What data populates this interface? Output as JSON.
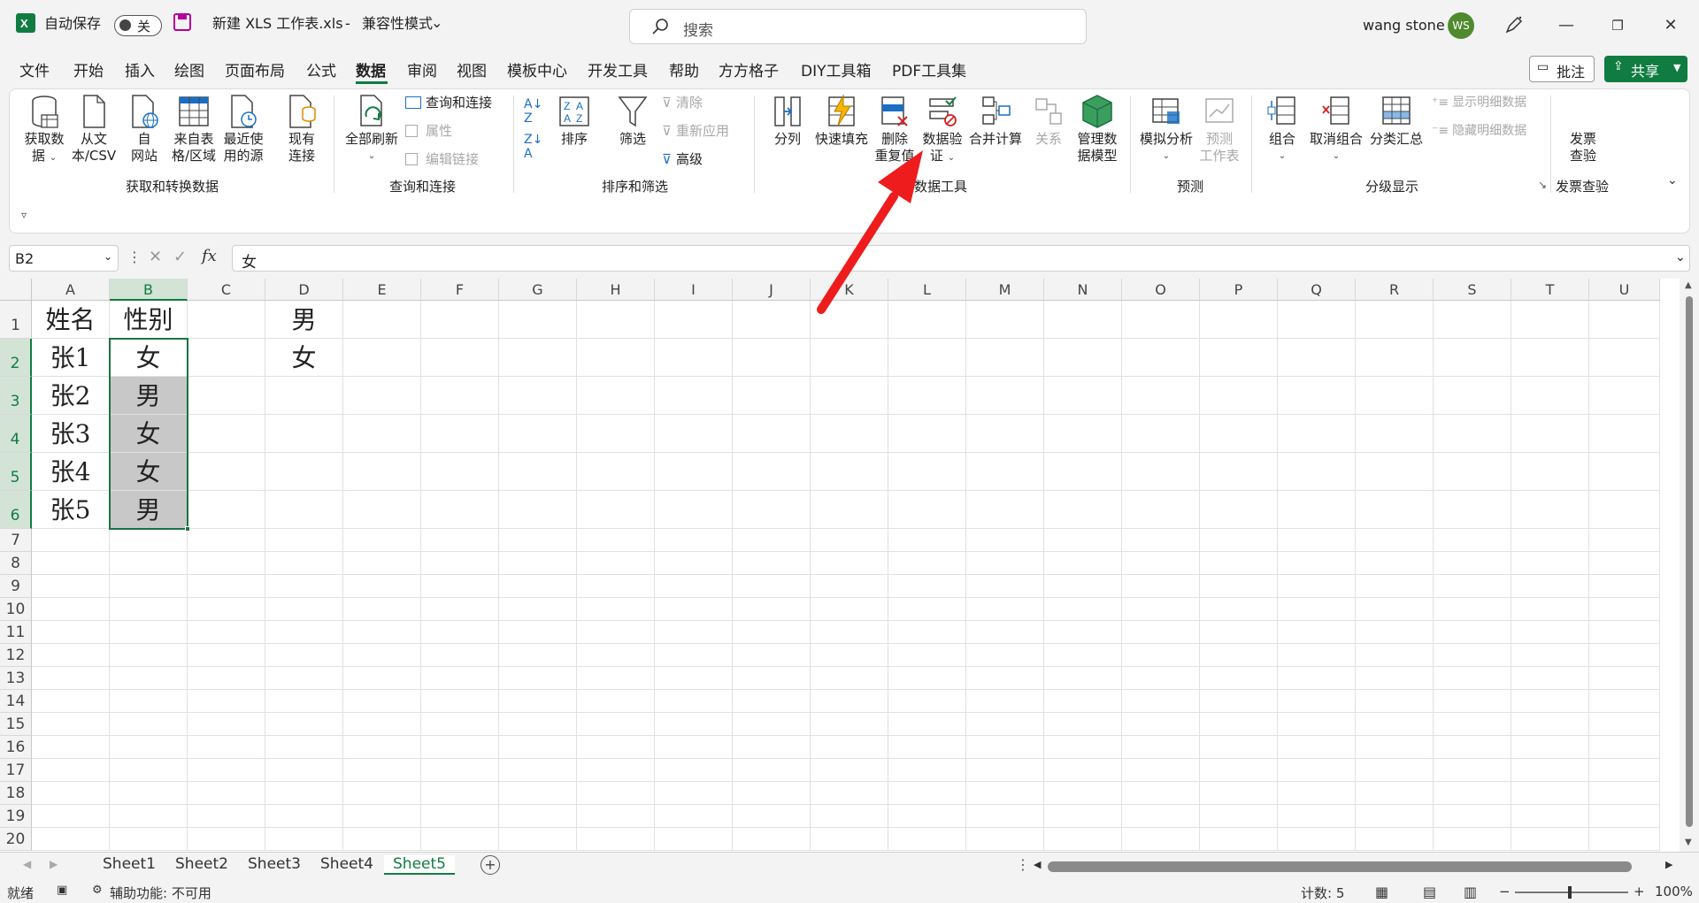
{
  "title": {
    "autosave_label": "自动保存",
    "autosave_state": "关",
    "filename": "新建 XLS 工作表.xls",
    "separator": "-",
    "mode": "兼容性模式",
    "search_placeholder": "搜索",
    "user_name": "wang stone",
    "avatar_initials": "WS"
  },
  "menu": {
    "items": [
      "文件",
      "开始",
      "插入",
      "绘图",
      "页面布局",
      "公式",
      "数据",
      "审阅",
      "视图",
      "模板中心",
      "开发工具",
      "帮助",
      "方方格子",
      "DIY工具箱",
      "PDF工具集"
    ],
    "active": "数据",
    "comment_label": "批注",
    "share_label": "共享"
  },
  "ribbon": {
    "groups": {
      "get_data": "获取和转换数据",
      "query": "查询和连接",
      "sort_filter": "排序和筛选",
      "data_tools": "数据工具",
      "forecast": "预测",
      "outline": "分级显示",
      "invoice": "发票查验"
    },
    "buttons": {
      "get_data_1": "获取数",
      "get_data_2": "据",
      "from_text_1": "从文",
      "from_text_2": "本/CSV",
      "from_web_1": "自",
      "from_web_2": "网站",
      "from_table_1": "来自表",
      "from_table_2": "格/区域",
      "recent_1": "最近使",
      "recent_2": "用的源",
      "existing_1": "现有",
      "existing_2": "连接",
      "refresh_all": "全部刷新",
      "queries": "查询和连接",
      "properties": "属性",
      "edit_links": "编辑链接",
      "sort": "排序",
      "filter": "筛选",
      "clear": "清除",
      "reapply": "重新应用",
      "advanced": "高级",
      "text_to_columns": "分列",
      "flash_fill": "快速填充",
      "remove_dup_1": "删除",
      "remove_dup_2": "重复值",
      "data_valid_1": "数据验",
      "data_valid_2": "证",
      "consolidate": "合并计算",
      "relationships": "关系",
      "manage_model_1": "管理数",
      "manage_model_2": "据模型",
      "whatif": "模拟分析",
      "forecast_1": "预测",
      "forecast_2": "工作表",
      "group": "组合",
      "ungroup": "取消组合",
      "subtotal": "分类汇总",
      "show_detail": "显示明细数据",
      "hide_detail": "隐藏明细数据",
      "invoice_1": "发票",
      "invoice_2": "查验"
    }
  },
  "formula_bar": {
    "name_box": "B2",
    "fx_label": "fx",
    "value": "女"
  },
  "grid": {
    "columns": [
      "A",
      "B",
      "C",
      "D",
      "E",
      "F",
      "G",
      "H",
      "I",
      "J",
      "K",
      "L",
      "M",
      "N",
      "O",
      "P",
      "Q",
      "R",
      "S",
      "T",
      "U"
    ],
    "rows": [
      "1",
      "2",
      "3",
      "4",
      "5",
      "6",
      "7",
      "8",
      "9",
      "10",
      "11",
      "12",
      "13",
      "14",
      "15",
      "16",
      "17",
      "18",
      "19",
      "20"
    ],
    "cells": {
      "A1": "姓名",
      "B1": "性别",
      "D1": "男",
      "A2": "张1",
      "B2": "女",
      "D2": "女",
      "A3": "张2",
      "B3": "男",
      "A4": "张3",
      "B4": "女",
      "A5": "张4",
      "B5": "女",
      "A6": "张5",
      "B6": "男"
    }
  },
  "sheets": {
    "tabs": [
      "Sheet1",
      "Sheet2",
      "Sheet3",
      "Sheet4",
      "Sheet5"
    ],
    "active": "Sheet5"
  },
  "status": {
    "ready": "就绪",
    "accessibility": "辅助功能: 不可用",
    "count": "计数: 5",
    "zoom": "100%"
  },
  "colors": {
    "accent": "#107c41",
    "arrow": "#ee1c1c"
  }
}
